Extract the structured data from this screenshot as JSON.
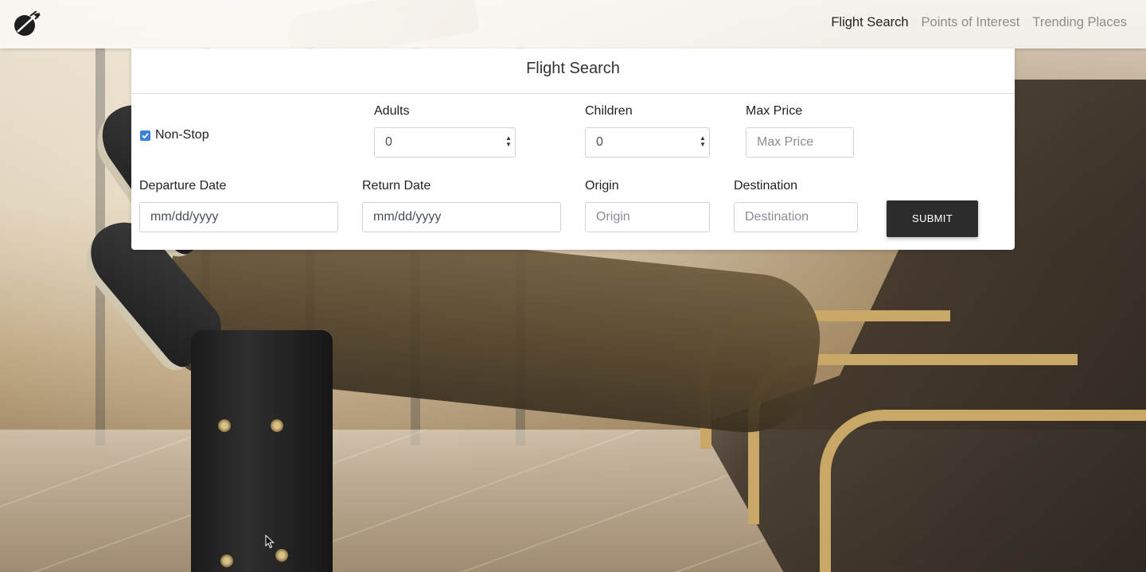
{
  "nav": {
    "logo_icon": "airplane-globe-icon",
    "links": [
      "Flight Search",
      "Points of Interest",
      "Trending Places"
    ],
    "active": "Flight Search"
  },
  "card": {
    "title": "Flight Search",
    "nonstop": {
      "label": "Non-Stop",
      "checked": true
    },
    "adults": {
      "label": "Adults",
      "value": "0"
    },
    "children": {
      "label": "Children",
      "value": "0"
    },
    "max_price": {
      "label": "Max Price",
      "placeholder": "Max Price"
    },
    "departure_date": {
      "label": "Departure Date",
      "placeholder": "mm/dd/yyyy"
    },
    "return_date": {
      "label": "Return Date",
      "placeholder": "mm/dd/yyyy"
    },
    "origin": {
      "label": "Origin",
      "placeholder": "Origin"
    },
    "destination": {
      "label": "Destination",
      "placeholder": "Destination"
    },
    "submit_label": "SUBMIT"
  },
  "colors": {
    "accent": "#3b82d8",
    "button": "#2c2c2c"
  }
}
